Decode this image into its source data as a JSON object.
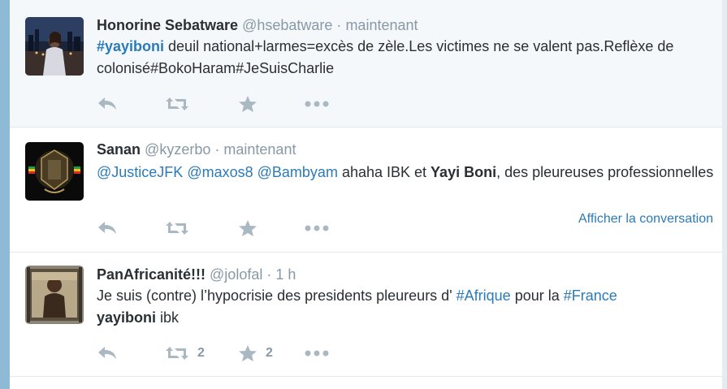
{
  "tweets": [
    {
      "name": "Honorine Sebatware",
      "handle": "@hsebatware",
      "sep": "·",
      "time": "maintenant",
      "text": {
        "hashtag": "#yayiboni",
        "rest": " deuil national+larmes=excès de zèle.Les victimes ne se valent pas.Reflèxe de colonisé#BokoHaram#JeSuisCharlie"
      },
      "retweets": "",
      "favorites": ""
    },
    {
      "name": "Sanan",
      "handle": "@kyzerbo",
      "sep": "·",
      "time": "maintenant",
      "text": {
        "mention1": "@JusticeJFK",
        "mention2": "@maxos8",
        "mention3": "@Bambyam",
        "mid": " ahaha IBK et ",
        "bold": "Yayi Boni",
        "end": ", des pleureuses professionnelles"
      },
      "conversation_link": "Afficher la conversation",
      "retweets": "",
      "favorites": ""
    },
    {
      "name": "PanAfricanité!!!",
      "handle": "@jolofal",
      "sep": "·",
      "time": "1 h",
      "text": {
        "start": "Je suis (contre) l’hypocrisie des presidents pleureurs d' ",
        "hashtag1": "#Afrique",
        "mid": " pour la ",
        "hashtag2": "#France",
        "bold": "yayiboni",
        "end": " ibk"
      },
      "retweets": "2",
      "favorites": "2"
    }
  ],
  "icons": {
    "reply": "reply-icon",
    "retweet": "retweet-icon",
    "favorite": "star-icon",
    "more": "more-dots-icon"
  },
  "colors": {
    "link": "#2b7bb9",
    "muted": "#8899a6",
    "action": "#aab8c2",
    "highlight_bg": "#f5f8fa"
  }
}
